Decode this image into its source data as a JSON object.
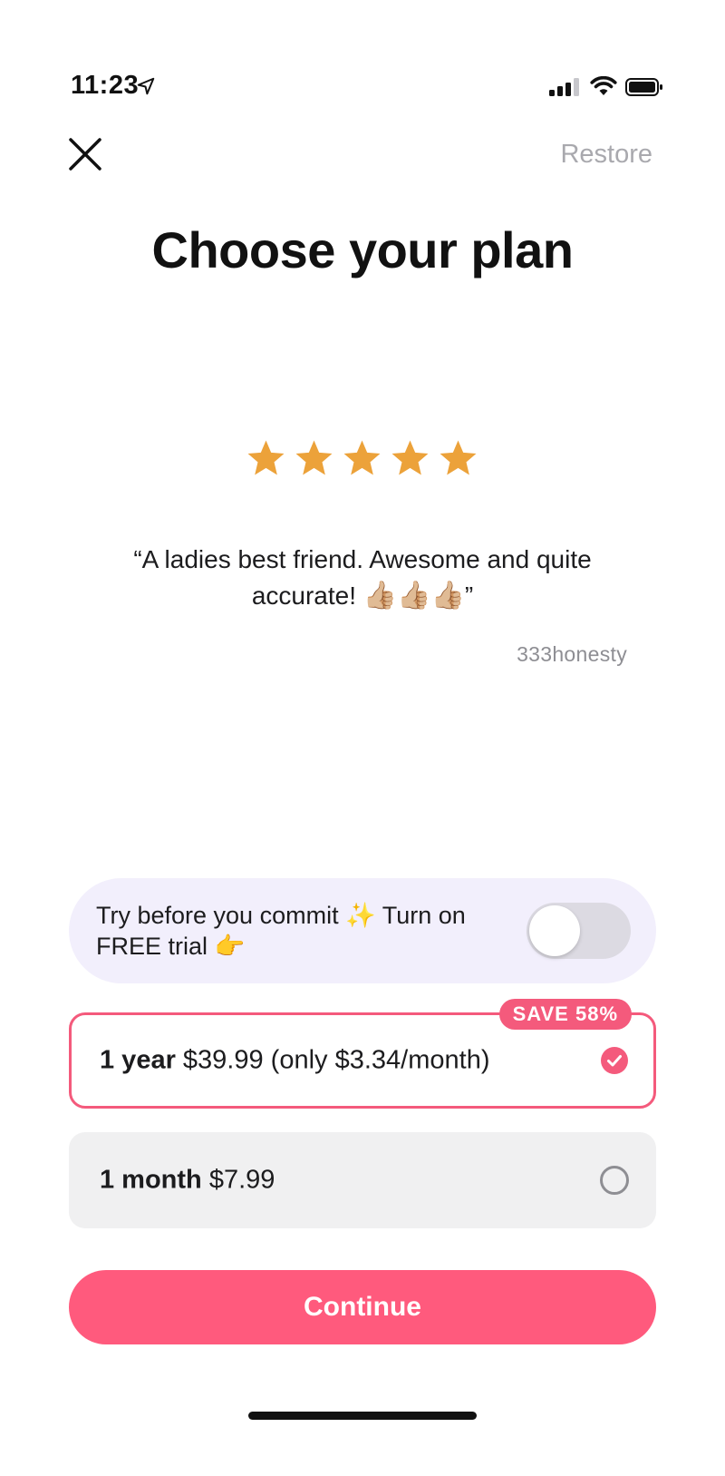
{
  "status_bar": {
    "time": "11:23",
    "icons": [
      "location-arrow-icon",
      "cellular-signal-icon",
      "wifi-icon",
      "battery-icon"
    ]
  },
  "header": {
    "close_icon": "close-icon",
    "restore_label": "Restore"
  },
  "title": "Choose your plan",
  "review": {
    "rating": 5,
    "rating_max": 5,
    "star_color": "#ECA23A",
    "quote_text": "“A ladies best friend. Awesome and quite accurate! ",
    "quote_emojis": "👍🏼👍🏼👍🏼",
    "quote_close": "”",
    "author": "333honesty"
  },
  "trial": {
    "text": "Try before you commit ✨ Turn on FREE trial 👉",
    "toggle_on": false
  },
  "plans": [
    {
      "name": "1 year",
      "price_text": "$39.99 (only $3.34/month)",
      "badge": "SAVE 58%",
      "selected": true
    },
    {
      "name": "1 month",
      "price_text": "$7.99",
      "selected": false
    }
  ],
  "continue_label": "Continue",
  "colors": {
    "accent": "#FF5A7D",
    "trial_bg": "#F2EFFC",
    "restore_text": "#A9A9AE"
  }
}
